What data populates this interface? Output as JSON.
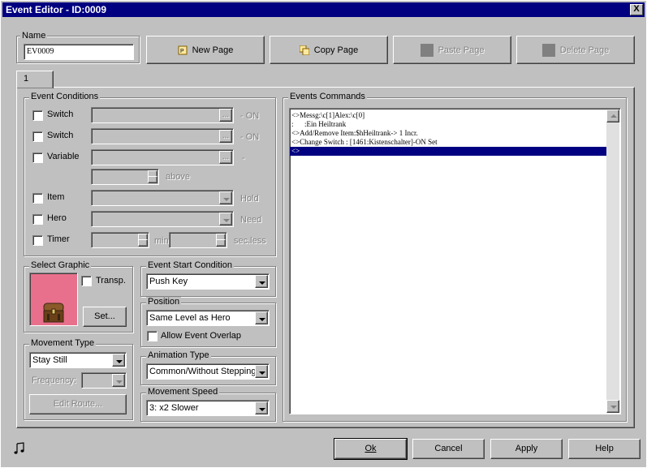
{
  "window": {
    "title": "Event Editor - ID:0009",
    "close_glyph": "X"
  },
  "name": {
    "label": "Name",
    "value": "EV0009"
  },
  "page_buttons": {
    "new_page": "New Page",
    "copy_page": "Copy Page",
    "paste_page": "Paste Page",
    "delete_page": "Delete Page"
  },
  "tab": {
    "label": "1"
  },
  "event_conditions": {
    "label": "Event Conditions",
    "switch1": {
      "label": "Switch",
      "suffix": "- ON"
    },
    "switch2": {
      "label": "Switch",
      "suffix": "- ON"
    },
    "variable": {
      "label": "Variable",
      "suffix": "-",
      "above": "above"
    },
    "item": {
      "label": "Item",
      "suffix": "Hold"
    },
    "hero": {
      "label": "Hero",
      "suffix": "Need"
    },
    "timer": {
      "label": "Timer",
      "min": "min",
      "sec": "sec.less"
    },
    "ellipsis": "..."
  },
  "graphic": {
    "label": "Select Graphic",
    "transparent_label": "Transp.",
    "set_button": "Set...",
    "icon": "treasure-chest-icon",
    "bg_color": "#e8708c"
  },
  "movement_type": {
    "label": "Movement Type",
    "value": "Stay Still",
    "frequency_label": "Frequency:",
    "edit_route": "Edit Route..."
  },
  "start_condition": {
    "label": "Event Start Condition",
    "value": "Push Key"
  },
  "position": {
    "label": "Position",
    "value": "Same Level as Hero",
    "overlap_label": "Allow Event Overlap"
  },
  "animation": {
    "label": "Animation Type",
    "value": "Common/Without Stepping"
  },
  "speed": {
    "label": "Movement Speed",
    "value": "3: x2 Slower"
  },
  "commands": {
    "label": "Events Commands",
    "lines": [
      "<>Messg:\\c[1]Alex:\\c[0]",
      ":      :Ein Heiltrank",
      "<>Add/Remove Item:$hHeiltrank-> 1 Incr.",
      "<>Change Switch : [1461:Kistenschalter]-ON Set",
      "<>"
    ],
    "selected_index": 4
  },
  "footer": {
    "music_icon": "music-note-icon",
    "ok": "Ok",
    "cancel": "Cancel",
    "apply": "Apply",
    "help": "Help"
  },
  "colors": {
    "titlebar": "#000080",
    "selection": "#000080",
    "face": "#c0c0c0"
  }
}
